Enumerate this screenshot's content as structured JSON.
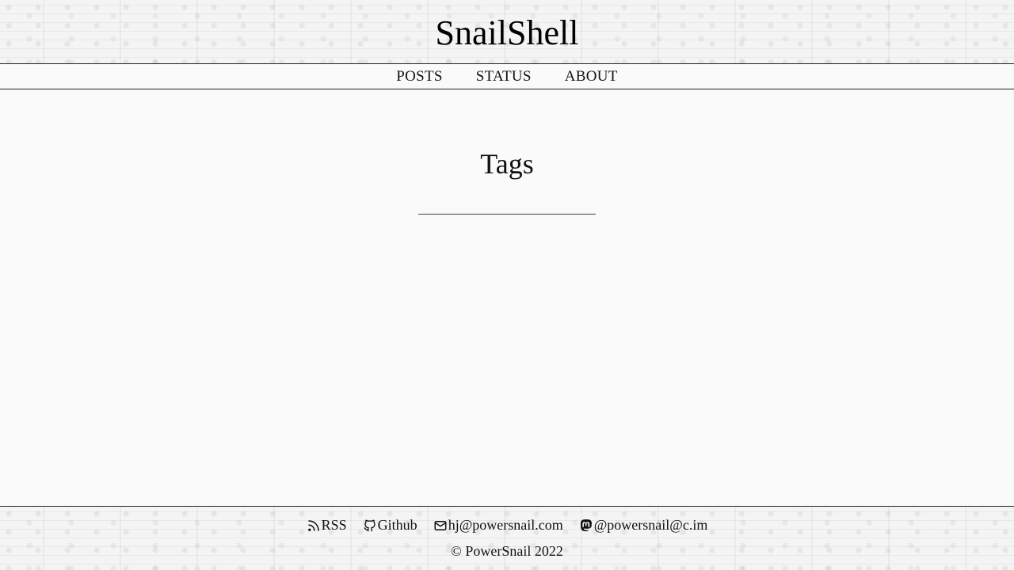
{
  "site": {
    "title": "SnailShell"
  },
  "nav": {
    "items": [
      {
        "label": "POSTS"
      },
      {
        "label": "STATUS"
      },
      {
        "label": "ABOUT"
      }
    ]
  },
  "main": {
    "heading": "Tags"
  },
  "footer": {
    "links": [
      {
        "icon": "rss-icon",
        "label": "RSS"
      },
      {
        "icon": "github-icon",
        "label": "Github"
      },
      {
        "icon": "mail-icon",
        "label": "hj@powersnail.com"
      },
      {
        "icon": "mastodon-icon",
        "label": "@powersnail@c.im"
      }
    ],
    "copyright": "© PowerSnail 2022"
  }
}
